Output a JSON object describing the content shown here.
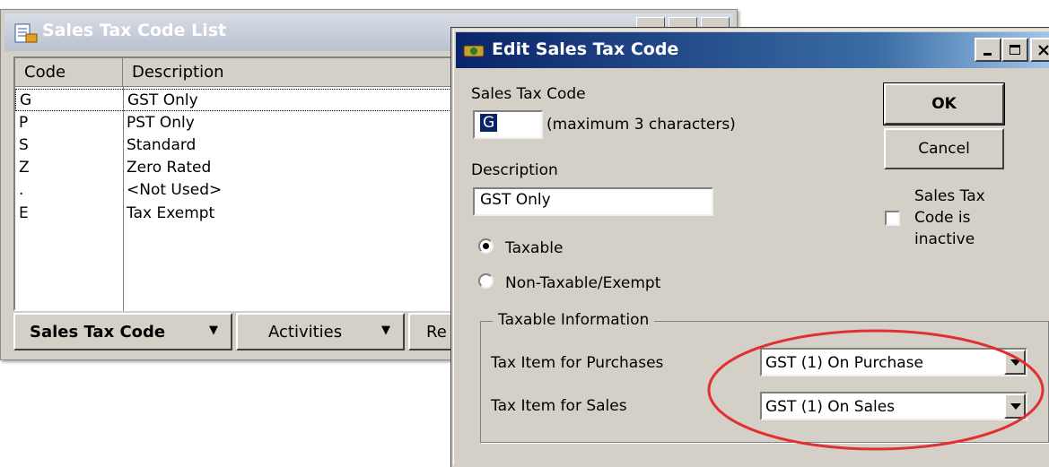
{
  "list_window": {
    "title": "Sales Tax Code List",
    "columns": [
      "Code",
      "Description"
    ],
    "rows": [
      {
        "code": "G",
        "description": "GST Only"
      },
      {
        "code": "P",
        "description": "PST Only"
      },
      {
        "code": "S",
        "description": "Standard"
      },
      {
        "code": "Z",
        "description": "Zero Rated"
      },
      {
        "code": ".",
        "description": "<Not Used>"
      },
      {
        "code": "E",
        "description": "Tax Exempt"
      }
    ],
    "buttons": {
      "sales_tax_code": "Sales Tax Code",
      "activities": "Activities",
      "reports_partial": "Re"
    }
  },
  "dialog": {
    "title": "Edit Sales Tax Code",
    "code_label": "Sales Tax Code",
    "code_value": "G",
    "code_hint": "(maximum 3 characters)",
    "description_label": "Description",
    "description_value": "GST Only",
    "radio_taxable": "Taxable",
    "radio_nontaxable": "Non-Taxable/Exempt",
    "taxable_selected": true,
    "ok_label": "OK",
    "cancel_label": "Cancel",
    "inactive_label_1": "Sales Tax",
    "inactive_label_2": "Code is",
    "inactive_label_3": "inactive",
    "inactive_checked": false,
    "group_title": "Taxable Information",
    "purchases_label": "Tax Item for Purchases",
    "purchases_value": "GST (1) On Purchase",
    "sales_label": "Tax Item for Sales",
    "sales_value": "GST (1) On Sales"
  },
  "colors": {
    "annotation_circle": "#e03030",
    "title_active": "#0a246a",
    "selection": "#0a246a"
  },
  "icons": [
    "list-icon",
    "tax-code-icon",
    "minimize-icon",
    "maximize-icon",
    "close-icon",
    "dropdown-arrow-icon"
  ]
}
